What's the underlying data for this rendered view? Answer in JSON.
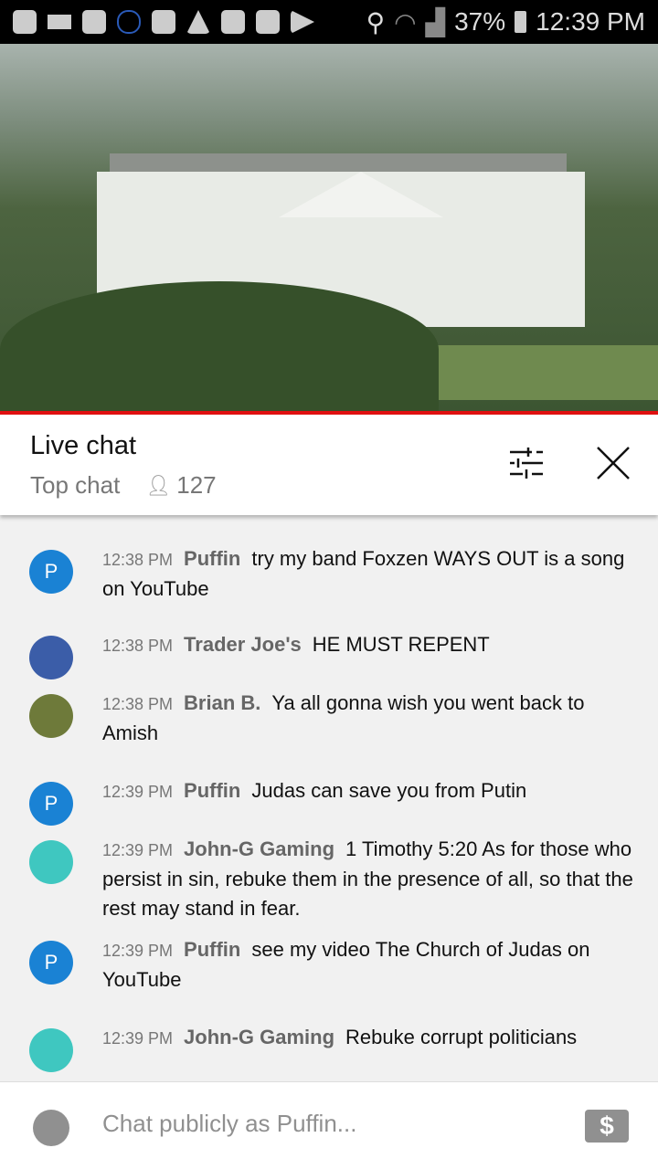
{
  "status_bar": {
    "battery": "37%",
    "time": "12:39 PM"
  },
  "chat": {
    "title": "Live chat",
    "mode": "Top chat",
    "viewers": "127",
    "messages": [
      {
        "time": "12:38 PM",
        "author": "Puffin",
        "text": "try my band Foxzen WAYS OUT is a song on YouTube",
        "avatar": "P",
        "avatar_color": "#1a82d4"
      },
      {
        "time": "12:38 PM",
        "author": "Trader Joe's",
        "text": "HE MUST REPENT",
        "avatar": "",
        "avatar_color": "#3b5da8"
      },
      {
        "time": "12:38 PM",
        "author": "Brian B.",
        "text": "Ya all gonna wish you went back to Amish",
        "avatar": "",
        "avatar_color": "#6e7a3a"
      },
      {
        "time": "12:39 PM",
        "author": "Puffin",
        "text": "Judas can save you from Putin",
        "avatar": "P",
        "avatar_color": "#1a82d4"
      },
      {
        "time": "12:39 PM",
        "author": "John-G Gaming",
        "text": "1 Timothy 5:20 As for those who persist in sin, rebuke them in the presence of all, so that the rest may stand in fear.",
        "avatar": "",
        "avatar_color": "#3fc7c0"
      },
      {
        "time": "12:39 PM",
        "author": "Puffin",
        "text": "see my video The Church of Judas on YouTube",
        "avatar": "P",
        "avatar_color": "#1a82d4"
      },
      {
        "time": "12:39 PM",
        "author": "John-G Gaming",
        "text": "Rebuke corrupt politicians",
        "avatar": "",
        "avatar_color": "#3fc7c0"
      }
    ]
  },
  "footer": {
    "placeholder": "Chat publicly as Puffin...",
    "super_chat_symbol": "$"
  }
}
